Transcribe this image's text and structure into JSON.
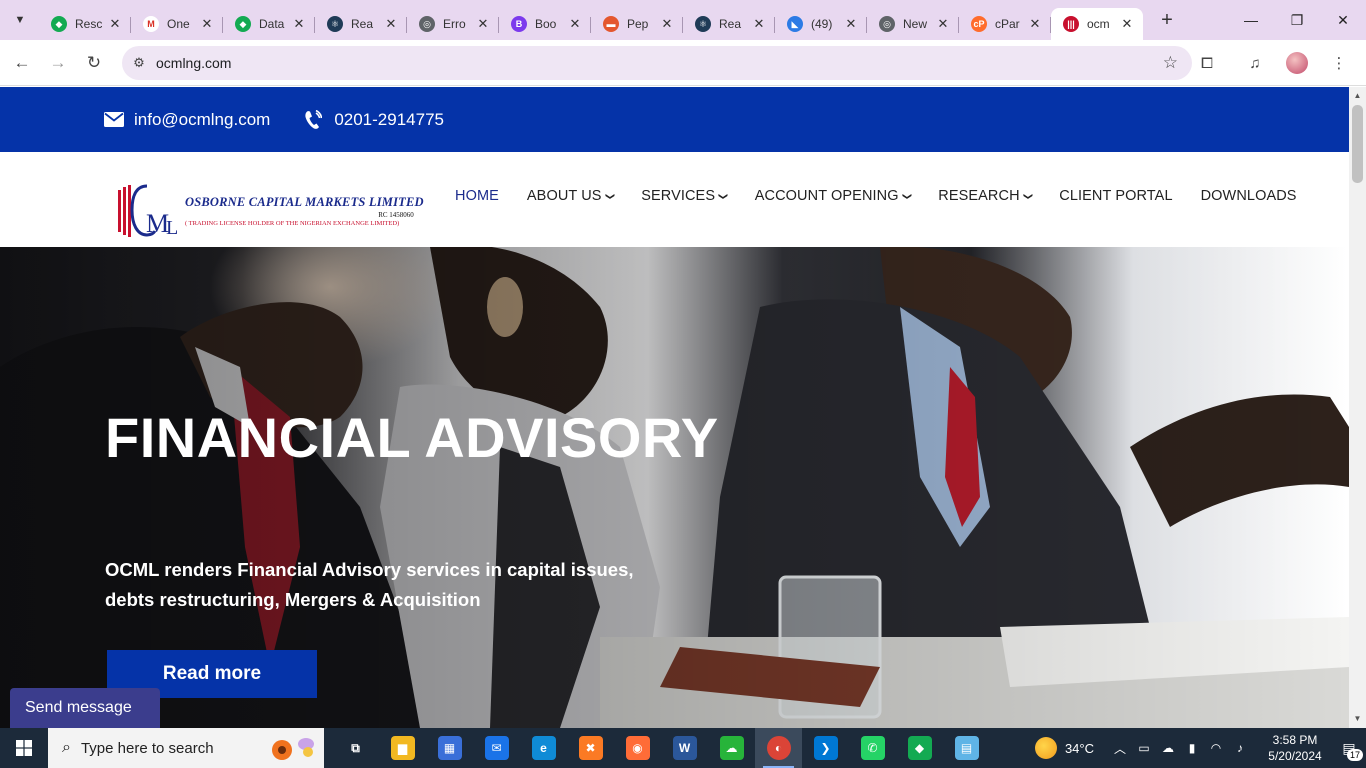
{
  "browser": {
    "tabs": [
      {
        "title": "Resc",
        "color": "#13aa52",
        "glyph": "◆",
        "active": false
      },
      {
        "title": "One",
        "color": "#ffffff",
        "glyph": "M",
        "active": false,
        "glyph_color": "#d93025"
      },
      {
        "title": "Data",
        "color": "#13aa52",
        "glyph": "◆",
        "active": false
      },
      {
        "title": "Rea",
        "color": "#1f3b57",
        "glyph": "⚛",
        "active": false
      },
      {
        "title": "Erro",
        "color": "#5f6368",
        "glyph": "◎",
        "active": false
      },
      {
        "title": "Boo",
        "color": "#7c3aed",
        "glyph": "B",
        "active": false
      },
      {
        "title": "Pep",
        "color": "#e4572e",
        "glyph": "▬",
        "active": false
      },
      {
        "title": "Rea",
        "color": "#1f3b57",
        "glyph": "⚛",
        "active": false
      },
      {
        "title": "(49)",
        "color": "#2c7be5",
        "glyph": "◣",
        "active": false
      },
      {
        "title": "New",
        "color": "#5f6368",
        "glyph": "◎",
        "active": false
      },
      {
        "title": "cPar",
        "color": "#ff6c2c",
        "glyph": "cP",
        "active": false
      },
      {
        "title": "ocm",
        "color": "#c8102e",
        "glyph": "|||",
        "active": true
      }
    ],
    "close_glyph": "✕",
    "new_tab_glyph": "+",
    "url": "ocmlng.com"
  },
  "site": {
    "email": "info@ocmlng.com",
    "phone": "0201-2914775",
    "logo": {
      "name": "OSBORNE CAPITAL MARKETS LIMITED",
      "rc": "RC 1458060",
      "sub": "( TRADING LICENSE HOLDER OF THE NIGERIAN EXCHANGE LIMITED)"
    },
    "nav": [
      {
        "label": "HOME",
        "dropdown": false,
        "active": true
      },
      {
        "label": "ABOUT US",
        "dropdown": true,
        "active": false
      },
      {
        "label": "SERVICES",
        "dropdown": true,
        "active": false
      },
      {
        "label": "ACCOUNT OPENING",
        "dropdown": true,
        "active": false
      },
      {
        "label": "RESEARCH",
        "dropdown": true,
        "active": false
      },
      {
        "label": "CLIENT PORTAL",
        "dropdown": false,
        "active": false
      },
      {
        "label": "DOWNLOADS",
        "dropdown": false,
        "active": false
      }
    ],
    "hero": {
      "title": "FINANCIAL ADVISORY",
      "description": "OCML renders Financial Advisory services in capital issues, debts restructuring, Mergers & Acquisition",
      "button": "Read more"
    },
    "send_message": "Send message",
    "colors": {
      "brand_blue": "#0533a8",
      "logo_red": "#c8102e",
      "logo_navy": "#1b2b8c"
    }
  },
  "taskbar": {
    "search_placeholder": "Type here to search",
    "apps": [
      {
        "name": "task-view",
        "glyph": "⧉",
        "color": "transparent"
      },
      {
        "name": "file-explorer",
        "glyph": "▆",
        "color": "#f2b821"
      },
      {
        "name": "microsoft-store",
        "glyph": "▦",
        "color": "#3a6fd8"
      },
      {
        "name": "mail",
        "glyph": "✉",
        "color": "#1a73e8"
      },
      {
        "name": "edge",
        "glyph": "e",
        "color": "#0f8bd6"
      },
      {
        "name": "xampp",
        "glyph": "✖",
        "color": "#fb7a24"
      },
      {
        "name": "postman",
        "glyph": "◉",
        "color": "#ff6c37"
      },
      {
        "name": "word",
        "glyph": "W",
        "color": "#2b579a"
      },
      {
        "name": "onedrive",
        "glyph": "☁",
        "color": "#27b43a"
      },
      {
        "name": "chrome",
        "glyph": "◐",
        "color": "#db4437",
        "active": true
      },
      {
        "name": "vscode",
        "glyph": "❯",
        "color": "#0078d4"
      },
      {
        "name": "whatsapp",
        "glyph": "✆",
        "color": "#25d366"
      },
      {
        "name": "mongodb-compass",
        "glyph": "◆",
        "color": "#13aa52"
      },
      {
        "name": "notepad",
        "glyph": "▤",
        "color": "#5fb4e6"
      }
    ],
    "temperature": "34°C",
    "time": "3:58 PM",
    "date": "5/20/2024",
    "notifications": "17"
  }
}
